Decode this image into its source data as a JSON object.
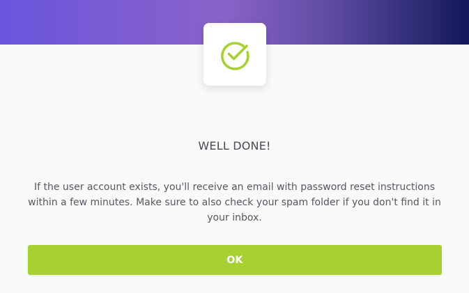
{
  "dialog": {
    "title": "WELL DONE!",
    "message": "If the user account exists, you'll receive an email with password reset instructions within a few minutes. Make sure to also check your spam folder if you don't find it in your inbox.",
    "ok_label": "OK",
    "icon": "check-circle-icon"
  },
  "colors": {
    "header_gradient_start": "#6a55de",
    "header_gradient_mid": "#8a63c8",
    "header_gradient_end": "#12185a",
    "accent_green": "#a6d130",
    "title_text": "#464a51",
    "body_text": "#54585f",
    "background": "#fafafa"
  }
}
